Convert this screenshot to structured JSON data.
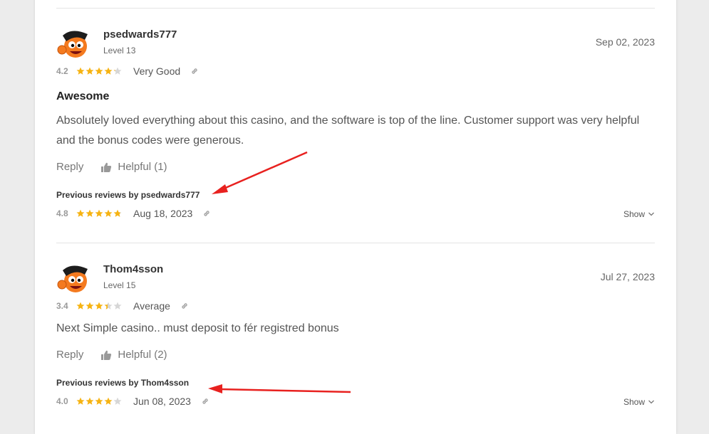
{
  "colors": {
    "star": "#f6b312",
    "star_empty": "#d6d6d6",
    "annotation": "#e8211f"
  },
  "reviews": [
    {
      "username": "psedwards777",
      "level": "Level 13",
      "date": "Sep 02, 2023",
      "score": "4.2",
      "rating": 4.2,
      "verdict": "Very Good",
      "title": "Awesome",
      "body": "Absolutely loved everything about this casino, and the software is top of the line. Customer support was very helpful and the bonus codes were generous.",
      "reply_label": "Reply",
      "helpful_label": "Helpful (1)",
      "previous_label": "Previous reviews by psedwards777",
      "previous": {
        "score": "4.8",
        "rating": 4.8,
        "date": "Aug 18, 2023",
        "show_label": "Show"
      }
    },
    {
      "username": "Thom4sson",
      "level": "Level 15",
      "date": "Jul 27, 2023",
      "score": "3.4",
      "rating": 3.4,
      "verdict": "Average",
      "title": "",
      "body": "Next Simple casino.. must deposit to fér registred bonus",
      "reply_label": "Reply",
      "helpful_label": "Helpful (2)",
      "previous_label": "Previous reviews by Thom4sson",
      "previous": {
        "score": "4.0",
        "rating": 4.0,
        "date": "Jun 08, 2023",
        "show_label": "Show"
      }
    }
  ]
}
